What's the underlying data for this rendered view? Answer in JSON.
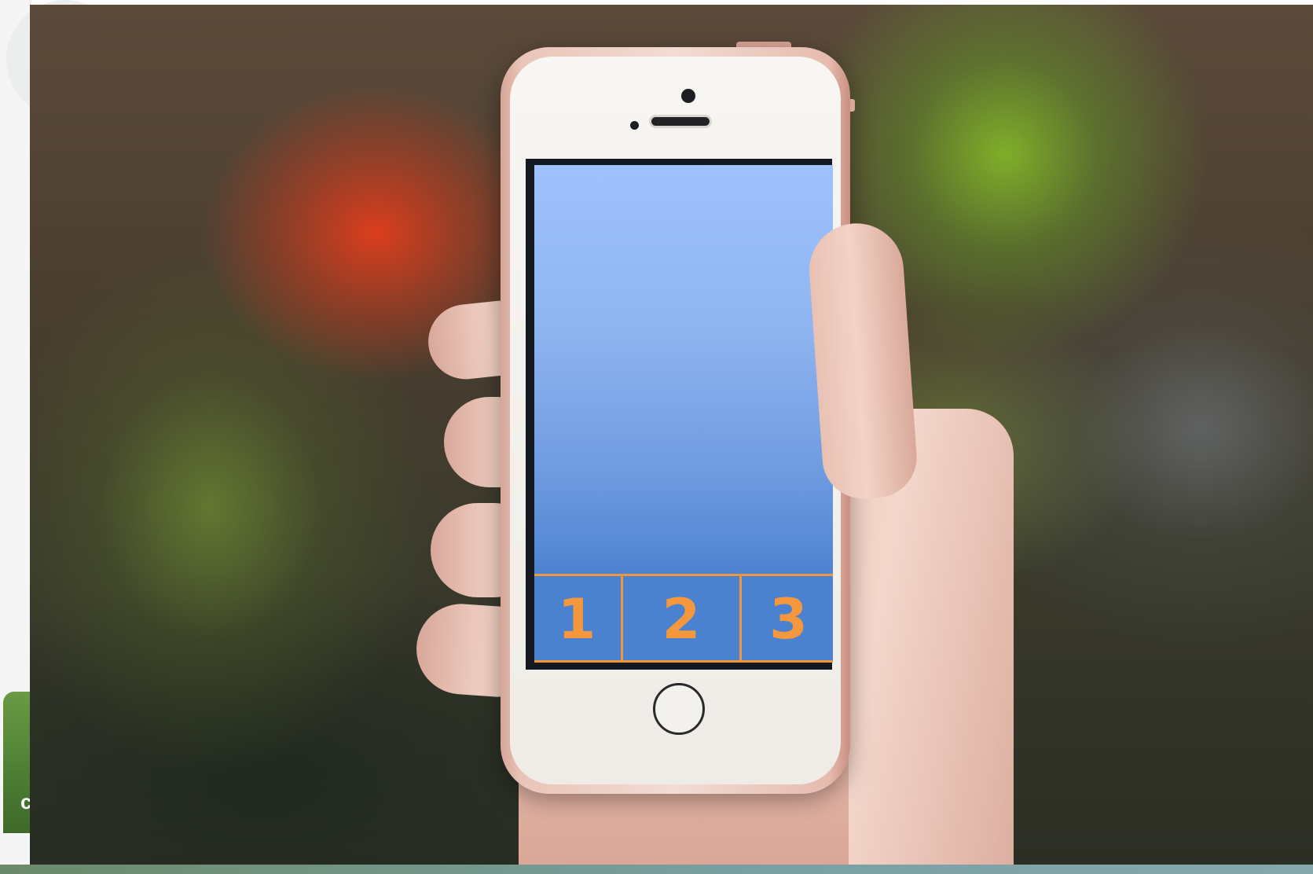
{
  "scene": {
    "description_colors": {
      "screen_top": "#9fc2fc",
      "screen_bottom": "#4e83d0",
      "tab_fill": "#4a82cf",
      "tab_accent": "#f0963e",
      "phone_body": "#eac4b8"
    }
  },
  "margin": {
    "character": "c"
  },
  "tabbar": {
    "tabs": [
      {
        "label": "1"
      },
      {
        "label": "2"
      },
      {
        "label": "3"
      }
    ]
  }
}
